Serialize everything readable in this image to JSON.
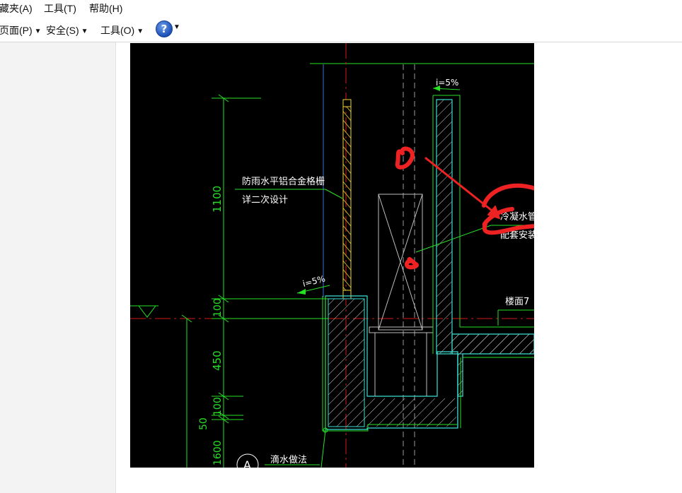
{
  "menu": {
    "favorites": "藏夹(A)",
    "tools": "工具(T)",
    "help": "帮助(H)"
  },
  "toolbar": {
    "page": "页面(P)",
    "safety": "安全(S)",
    "tools": "工具(O)",
    "help_glyph": "?"
  },
  "drawing": {
    "note_grille_line1": "防雨水平铝合金格栅",
    "note_grille_line2": "详二次设计",
    "slope_left": "i=5%",
    "slope_top": "i=5%",
    "dim_1100": "1100",
    "dim_100_upper": "100",
    "dim_450": "450",
    "dim_100_lower": "100",
    "dim_50": "50",
    "dim_1600": "1600",
    "note_pipe_line1": "冷凝水管",
    "note_pipe_line2": "配套安装",
    "floor_label": "楼面7",
    "drip_label": "滴水做法",
    "section_marker": "A"
  },
  "colors": {
    "cad_background": "#000000",
    "outline_green": "#26e026",
    "wall_cyan": "#39e0d0",
    "hatch_white": "#dcdcdc",
    "grille_yellow": "#f0d23a",
    "axis_red": "#d21a1a",
    "markup_red": "#ee2222",
    "guide_blue": "#3a6fd6"
  }
}
